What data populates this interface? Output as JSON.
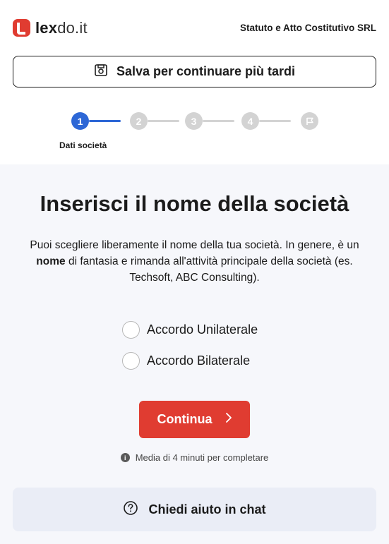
{
  "header": {
    "logo_strong": "lex",
    "logo_light": "do.it",
    "document_title": "Statuto e Atto Costitutivo SRL",
    "save_label": "Salva per continuare più tardi"
  },
  "stepper": {
    "steps": [
      "1",
      "2",
      "3",
      "4"
    ],
    "current_step_caption": "Dati società"
  },
  "main": {
    "heading": "Inserisci il nome della società",
    "description_before": "Puoi scegliere liberamente il nome della tua società. In genere, è un ",
    "description_bold": "nome",
    "description_after": " di fantasia e rimanda all'attività principale della società (es. Techsoft, ABC Consulting).",
    "options": [
      {
        "label": "Accordo Unilaterale",
        "checked": false
      },
      {
        "label": "Accordo Bilaterale",
        "checked": false
      }
    ],
    "continue_label": "Continua",
    "hint": "Media di 4 minuti per completare",
    "chat_label": "Chiedi aiuto in chat"
  },
  "colors": {
    "brand_red": "#e03c31",
    "step_active_blue": "#2d67d6",
    "step_inactive": "#d3d3d3",
    "panel_bg": "#f6f7fb",
    "chat_bg": "#eaedf6"
  }
}
